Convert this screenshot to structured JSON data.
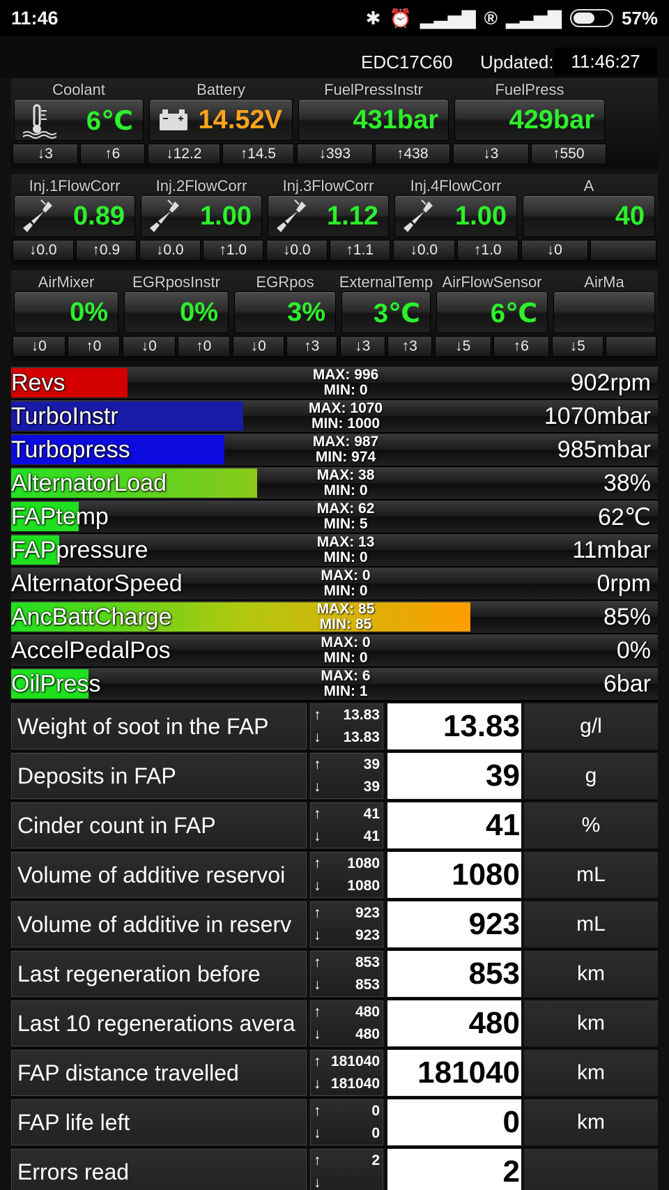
{
  "status_bar": {
    "time": "11:46",
    "battery_percent": "57%",
    "battery_level": 0.57,
    "icons": [
      "bluetooth-icon",
      "alarm-icon",
      "signal-icon",
      "roaming-icon",
      "signal-icon",
      "battery-icon"
    ]
  },
  "header": {
    "ecu": "EDC17C60",
    "updated_label": "Updated:",
    "updated_time": "11:46:27"
  },
  "gauge_rows": [
    {
      "cells": [
        {
          "label": "Coolant",
          "value": "6℃",
          "min": "↓3",
          "max": "↑6",
          "icon": "thermometer-icon",
          "color": "#2cf02c"
        },
        {
          "label": "Battery",
          "value": "14.52V",
          "min": "↓12.2",
          "max": "↑14.5",
          "icon": "car-battery-icon",
          "color": "#ffa31a"
        },
        {
          "label": "FuelPressInstr",
          "value": "431bar",
          "min": "↓393",
          "max": "↑438",
          "icon": "",
          "color": "#2cf02c"
        },
        {
          "label": "FuelPress",
          "value": "429bar",
          "min": "↓3",
          "max": "↑550",
          "icon": "",
          "color": "#2cf02c"
        }
      ]
    },
    {
      "cells": [
        {
          "label": "Inj.1FlowCorr",
          "value": "0.89",
          "min": "↓0.0",
          "max": "↑0.9",
          "icon": "injector-icon",
          "color": "#2cf02c"
        },
        {
          "label": "Inj.2FlowCorr",
          "value": "1.00",
          "min": "↓0.0",
          "max": "↑1.0",
          "icon": "injector-icon",
          "color": "#2cf02c"
        },
        {
          "label": "Inj.3FlowCorr",
          "value": "1.12",
          "min": "↓0.0",
          "max": "↑1.1",
          "icon": "injector-icon",
          "color": "#2cf02c"
        },
        {
          "label": "Inj.4FlowCorr",
          "value": "1.00",
          "min": "↓0.0",
          "max": "↑1.0",
          "icon": "injector-icon",
          "color": "#2cf02c"
        },
        {
          "label": "A",
          "value": "40",
          "min": "↓0",
          "max": "",
          "icon": "",
          "color": "#2cf02c"
        }
      ]
    },
    {
      "cells": [
        {
          "label": "AirMixer",
          "value": "0%",
          "min": "↓0",
          "max": "↑0",
          "icon": "",
          "color": "#2cf02c"
        },
        {
          "label": "EGRposInstr",
          "value": "0%",
          "min": "↓0",
          "max": "↑0",
          "icon": "",
          "color": "#2cf02c"
        },
        {
          "label": "EGRpos",
          "value": "3%",
          "min": "↓0",
          "max": "↑3",
          "icon": "",
          "color": "#2cf02c"
        },
        {
          "label": "ExternalTemp",
          "value": "3℃",
          "min": "↓3",
          "max": "↑3",
          "icon": "",
          "color": "#2cf02c"
        },
        {
          "label": "AirFlowSensor",
          "value": "6℃",
          "min": "↓5",
          "max": "↑6",
          "icon": "",
          "color": "#2cf02c"
        },
        {
          "label": "AirMa",
          "value": "",
          "min": "↓5",
          "max": "",
          "icon": "",
          "color": "#2cf02c"
        }
      ]
    }
  ],
  "bars": [
    {
      "name": "Revs",
      "max": "MAX: 996",
      "min": "MIN: 0",
      "value": "902rpm",
      "fill_fraction": 0.18,
      "fill_color": "#d40000"
    },
    {
      "name": "TurboInstr",
      "max": "MAX: 1070",
      "min": "MIN: 1000",
      "value": "1070mbar",
      "fill_fraction": 0.359,
      "fill_color": "#1a1aa8"
    },
    {
      "name": "Turbopress",
      "max": "MAX: 987",
      "min": "MIN: 974",
      "value": "985mbar",
      "fill_fraction": 0.33,
      "fill_color": "#0b0be0"
    },
    {
      "name": "AlternatorLoad",
      "max": "MAX: 38",
      "min": "MIN: 0",
      "value": "38%",
      "fill_fraction": 0.38,
      "fill_color": "#44d01a"
    },
    {
      "name": "FAPtemp",
      "max": "MAX: 62",
      "min": "MIN: 5",
      "value": "62℃",
      "fill_fraction": 0.105,
      "fill_color": "#1fe01f"
    },
    {
      "name": "FAPpressure",
      "max": "MAX: 13",
      "min": "MIN: 0",
      "value": "11mbar",
      "fill_fraction": 0.074,
      "fill_color": "#1fe01f"
    },
    {
      "name": "AlternatorSpeed",
      "max": "MAX: 0",
      "min": "MIN: 0",
      "value": "0rpm",
      "fill_fraction": 0,
      "fill_color": "#1fe01f"
    },
    {
      "name": "AncBattCharge",
      "max": "MAX: 85",
      "min": "MIN: 85",
      "value": "85%",
      "fill_fraction": 0.71,
      "fill_color": "#ff9d00"
    },
    {
      "name": "AccelPedalPos",
      "max": "MAX: 0",
      "min": "MIN: 0",
      "value": "0%",
      "fill_fraction": 0,
      "fill_color": "#1fe01f"
    },
    {
      "name": "OilPress",
      "max": "MAX: 6",
      "min": "MIN: 1",
      "value": "6bar",
      "fill_fraction": 0.12,
      "fill_color": "#1fe01f"
    }
  ],
  "table": [
    {
      "name": "Weight of soot in the FAP",
      "up": "13.83",
      "down": "13.83",
      "value": "13.83",
      "unit": "g/l"
    },
    {
      "name": "Deposits in FAP",
      "up": "39",
      "down": "39",
      "value": "39",
      "unit": "g"
    },
    {
      "name": "Cinder count in FAP",
      "up": "41",
      "down": "41",
      "value": "41",
      "unit": "%"
    },
    {
      "name": "Volume of additive reservoi",
      "up": "1080",
      "down": "1080",
      "value": "1080",
      "unit": "mL"
    },
    {
      "name": "Volume of additive in reserv",
      "up": "923",
      "down": "923",
      "value": "923",
      "unit": "mL"
    },
    {
      "name": "Last regeneration before",
      "up": "853",
      "down": "853",
      "value": "853",
      "unit": "km"
    },
    {
      "name": "Last 10 regenerations avera",
      "up": "480",
      "down": "480",
      "value": "480",
      "unit": "km"
    },
    {
      "name": "FAP distance travelled",
      "up": "181040",
      "down": "181040",
      "value": "181040",
      "unit": "km"
    },
    {
      "name": "FAP life left",
      "up": "0",
      "down": "0",
      "value": "0",
      "unit": "km"
    },
    {
      "name": "Errors read",
      "up": "2",
      "down": "",
      "value": "2",
      "unit": ""
    }
  ]
}
